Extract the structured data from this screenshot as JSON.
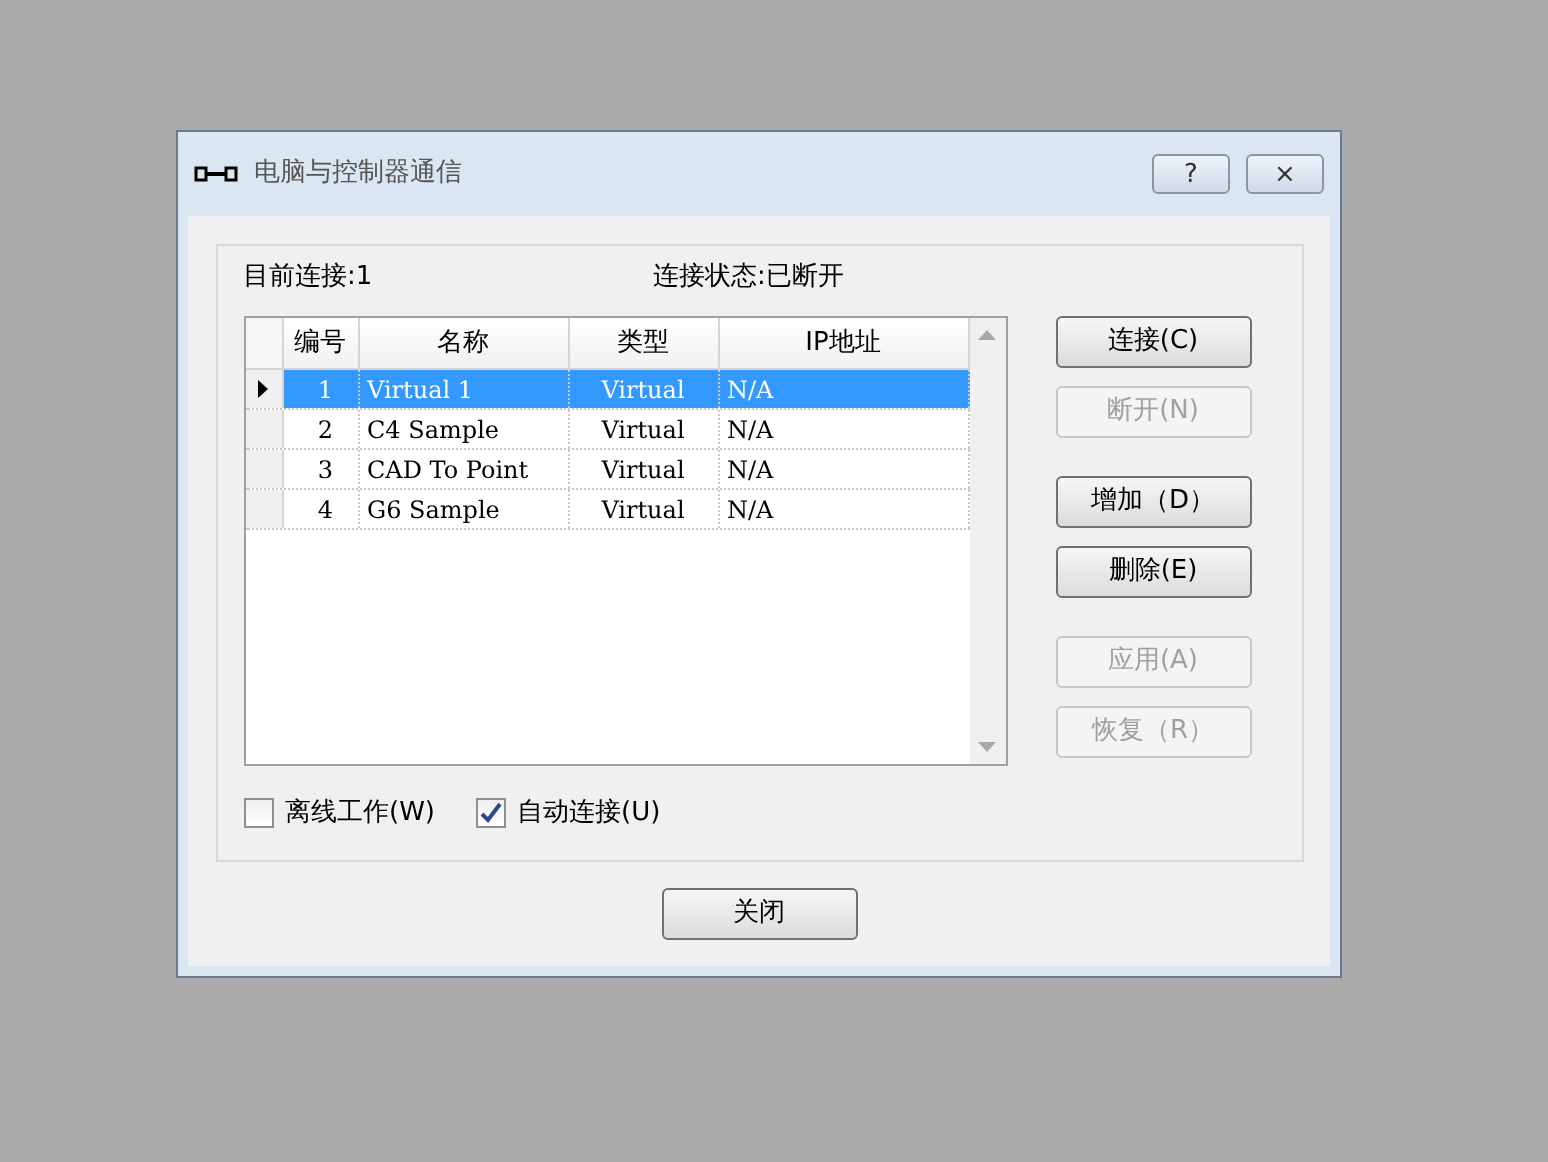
{
  "window": {
    "title": "电脑与控制器通信",
    "title_buttons": [
      "?",
      "×"
    ]
  },
  "status": {
    "current": "目前连接:1",
    "state": "连接状态:已断开"
  },
  "table": {
    "columns": [
      "编号",
      "名称",
      "类型",
      "IP地址"
    ],
    "rows": [
      {
        "cells": [
          "1",
          "Virtual 1",
          "Virtual",
          "N/A"
        ],
        "selected": true
      },
      {
        "cells": [
          "2",
          "C4 Sample",
          "Virtual",
          "N/A"
        ],
        "selected": false
      },
      {
        "cells": [
          "3",
          "CAD To Point",
          "Virtual",
          "N/A"
        ],
        "selected": false
      },
      {
        "cells": [
          "4",
          "G6 Sample",
          "Virtual",
          "N/A"
        ],
        "selected": false
      }
    ]
  },
  "side_buttons": [
    [
      {
        "label": "连接(C)",
        "disabled": false
      },
      {
        "label": "断开(N)",
        "disabled": true
      }
    ],
    [
      {
        "label": "增加（D）",
        "disabled": false
      },
      {
        "label": "删除(E)",
        "disabled": false
      }
    ],
    [
      {
        "label": "应用(A)",
        "disabled": true
      },
      {
        "label": "恢复（R）",
        "disabled": true
      }
    ]
  ],
  "checkboxes": [
    {
      "label": "离线工作(W)",
      "checked": false
    },
    {
      "label": "自动连接(U)",
      "checked": true
    }
  ],
  "close_button": "关闭"
}
